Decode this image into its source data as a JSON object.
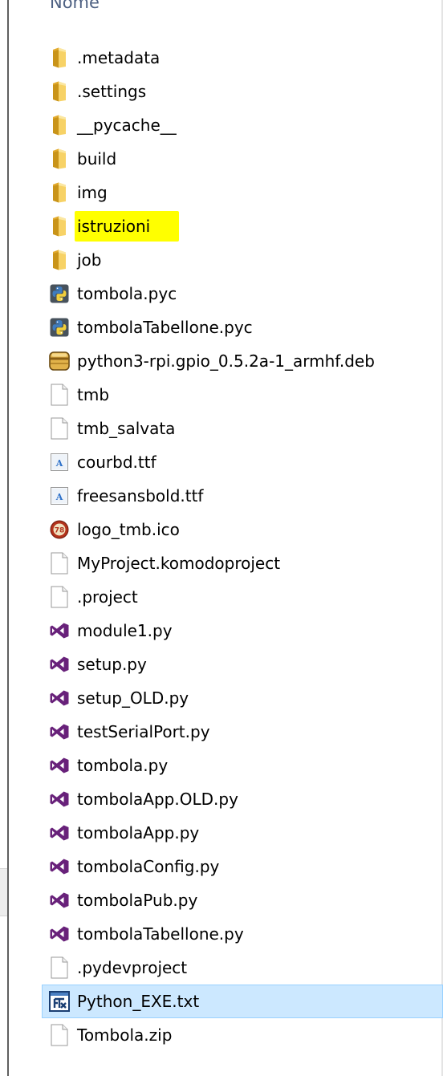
{
  "header": {
    "name_column": "Nome"
  },
  "colors": {
    "folder": "#e8b83c",
    "highlight": "#ffff00",
    "selected_bg": "#cce8ff",
    "selected_border": "#99d1ff",
    "vs_purple": "#68217a"
  },
  "files": [
    {
      "name": ".metadata",
      "icon": "folder-icon"
    },
    {
      "name": ".settings",
      "icon": "folder-icon"
    },
    {
      "name": "__pycache__",
      "icon": "folder-icon"
    },
    {
      "name": "build",
      "icon": "folder-icon"
    },
    {
      "name": "img",
      "icon": "folder-icon"
    },
    {
      "name": "istruzioni",
      "icon": "folder-icon",
      "highlighted": true
    },
    {
      "name": "job",
      "icon": "folder-icon"
    },
    {
      "name": "tombola.pyc",
      "icon": "python-compiled-icon"
    },
    {
      "name": "tombolaTabellone.pyc",
      "icon": "python-compiled-icon"
    },
    {
      "name": "python3-rpi.gpio_0.5.2a-1_armhf.deb",
      "icon": "package-icon"
    },
    {
      "name": "tmb",
      "icon": "blank-file-icon"
    },
    {
      "name": "tmb_salvata",
      "icon": "blank-file-icon"
    },
    {
      "name": "courbd.ttf",
      "icon": "font-file-icon"
    },
    {
      "name": "freesansbold.ttf",
      "icon": "font-file-icon"
    },
    {
      "name": "logo_tmb.ico",
      "icon": "tombola-logo-icon"
    },
    {
      "name": "MyProject.komodoproject",
      "icon": "blank-file-icon"
    },
    {
      "name": ".project",
      "icon": "blank-file-icon"
    },
    {
      "name": "module1.py",
      "icon": "visual-studio-icon"
    },
    {
      "name": "setup.py",
      "icon": "visual-studio-icon"
    },
    {
      "name": "setup_OLD.py",
      "icon": "visual-studio-icon"
    },
    {
      "name": "testSerialPort.py",
      "icon": "visual-studio-icon"
    },
    {
      "name": "tombola.py",
      "icon": "visual-studio-icon"
    },
    {
      "name": "tombolaApp.OLD.py",
      "icon": "visual-studio-icon"
    },
    {
      "name": "tombolaApp.py",
      "icon": "visual-studio-icon"
    },
    {
      "name": "tombolaConfig.py",
      "icon": "visual-studio-icon"
    },
    {
      "name": "tombolaPub.py",
      "icon": "visual-studio-icon"
    },
    {
      "name": "tombolaTabellone.py",
      "icon": "visual-studio-icon"
    },
    {
      "name": ".pydevproject",
      "icon": "blank-file-icon"
    },
    {
      "name": "Python_EXE.txt",
      "icon": "text-editor-icon",
      "selected": true
    },
    {
      "name": "Tombola.zip",
      "icon": "blank-file-icon"
    }
  ]
}
